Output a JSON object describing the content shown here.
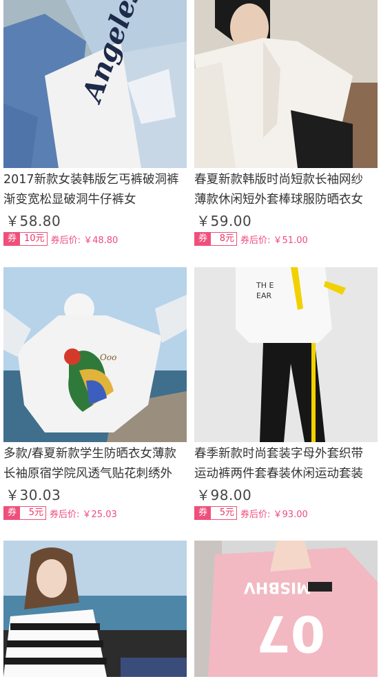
{
  "products": [
    {
      "title_line1": "2017新款女装韩版乞丐裤破洞裤",
      "title_line2": "渐变宽松显破洞牛仔裤女",
      "price": "￥58.80",
      "coupon_tag": "券",
      "coupon_amount": "10元",
      "after_price": "券后价: ￥48.80",
      "photo_text": "Angeles"
    },
    {
      "title_line1": "春夏新款韩版时尚短款长袖网纱",
      "title_line2": "薄款休闲短外套棒球服防晒衣女",
      "price": "￥59.00",
      "coupon_tag": "券",
      "coupon_amount": "8元",
      "after_price": "券后价: ￥51.00"
    },
    {
      "title_line1": "多款/春夏新款学生防晒衣女薄款",
      "title_line2": "长袖原宿学院风透气贴花刺绣外",
      "price": "￥30.03",
      "coupon_tag": "券",
      "coupon_amount": "5元",
      "after_price": "券后价: ￥25.03"
    },
    {
      "title_line1": "春季新款时尚套装字母外套织带",
      "title_line2": "运动裤两件套春装休闲运动套装",
      "price": "￥98.00",
      "coupon_tag": "券",
      "coupon_amount": "5元",
      "after_price": "券后价: ￥93.00"
    },
    {
      "photo_text": "MISBHV 07"
    },
    {}
  ],
  "colors": {
    "accent": "#ef4f7b",
    "price_text": "#444444",
    "title_text": "#333333"
  }
}
